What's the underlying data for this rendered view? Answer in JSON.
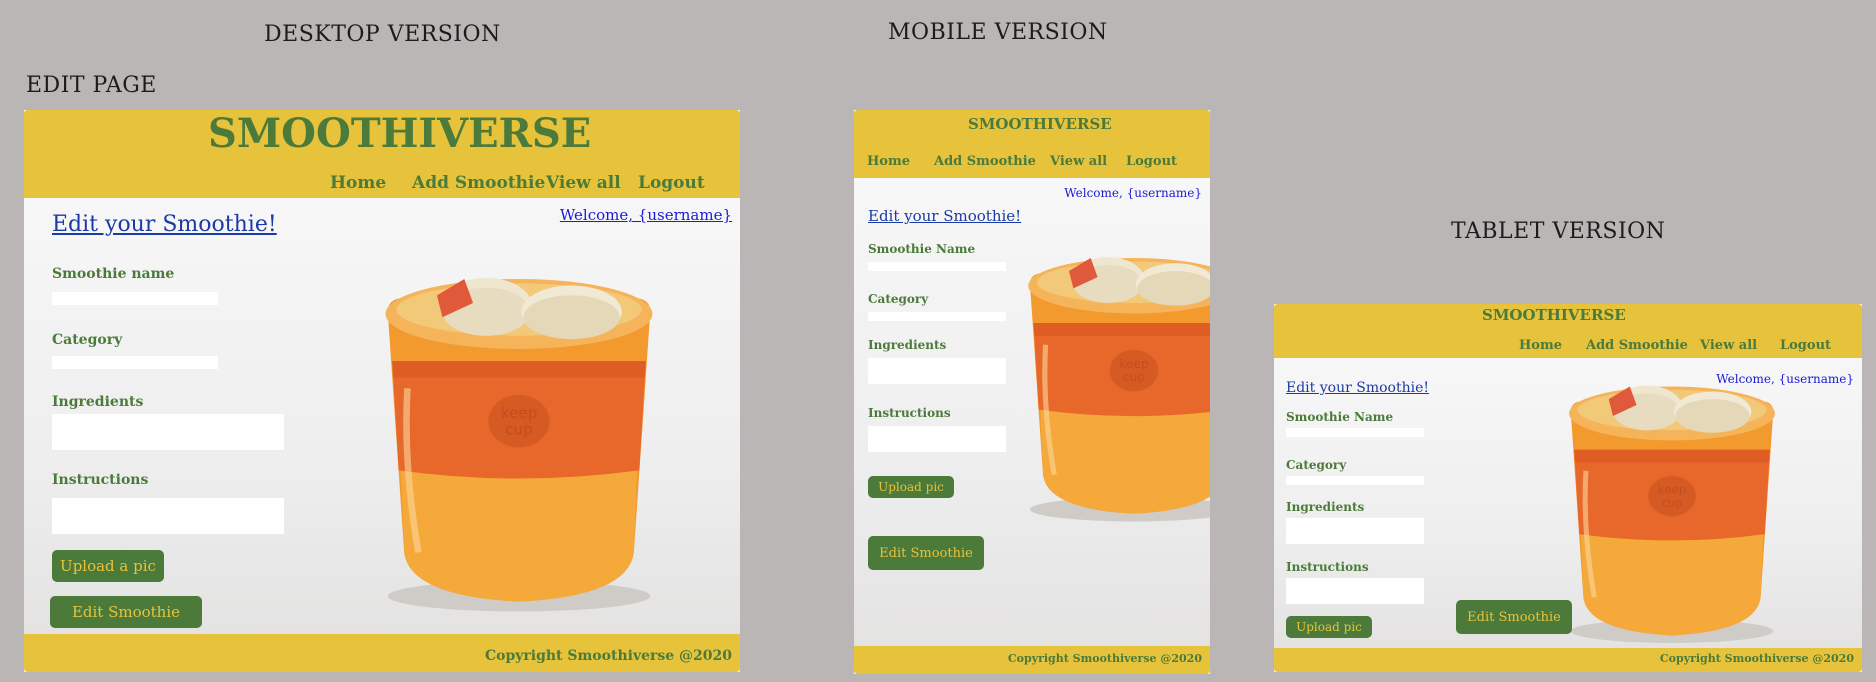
{
  "labels": {
    "desktop": "DESKTOP VERSION",
    "mobile": "MOBILE VERSION",
    "tablet": "TABLET VERSION",
    "edit_page": "EDIT PAGE"
  },
  "colors": {
    "header_bg": "#e7c33b",
    "brand_green": "#4b7a3a",
    "welcome_blue": "#1b1bd1",
    "page_bg": "#b9b6b5"
  },
  "desktop": {
    "brand": "SMOOTHIVERSE",
    "nav": [
      "Home",
      "Add Smoothie",
      "View all",
      "Logout"
    ],
    "welcome": "Welcome, {username}",
    "title": "Edit your Smoothie!",
    "fields": [
      "Smoothie name",
      "Category",
      "Ingredients",
      "Instructions"
    ],
    "upload": "Upload a pic",
    "submit": "Edit Smoothie",
    "copyright": "Copyright Smoothiverse @2020"
  },
  "mobile": {
    "brand": "SMOOTHIVERSE",
    "nav": [
      "Home",
      "Add Smoothie",
      "View all",
      "Logout"
    ],
    "welcome": "Welcome, {username}",
    "title": "Edit your Smoothie!",
    "fields": [
      "Smoothie Name",
      "Category",
      "Ingredients",
      "Instructions"
    ],
    "upload": "Upload pic",
    "submit": "Edit Smoothie",
    "copyright": "Copyright Smoothiverse @2020"
  },
  "tablet": {
    "brand": "SMOOTHIVERSE",
    "nav": [
      "Home",
      "Add Smoothie",
      "View all",
      "Logout"
    ],
    "welcome": "Welcome, {username}",
    "title": "Edit your Smoothie!",
    "fields": [
      "Smoothie Name",
      "Category",
      "Ingredients",
      "Instructions"
    ],
    "upload": "Upload pic",
    "submit": "Edit Smoothie",
    "copyright": "Copyright Smoothiverse @2020"
  }
}
